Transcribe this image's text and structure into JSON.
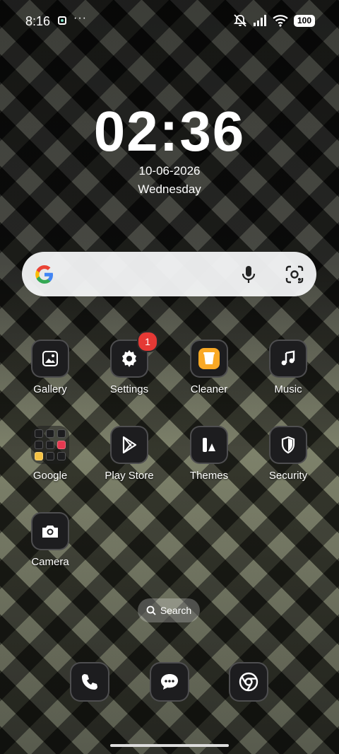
{
  "status_bar": {
    "time": "8:16",
    "more": "···",
    "battery": "100",
    "icons": [
      "notification-icon",
      "mute-icon",
      "signal-icon",
      "wifi-icon",
      "battery-icon"
    ]
  },
  "clock": {
    "time": "02:36",
    "date": "10-06-2026",
    "weekday": "Wednesday"
  },
  "google_search": {
    "icons": [
      "google-logo",
      "mic-icon",
      "lens-icon"
    ]
  },
  "apps": [
    {
      "label": "Gallery",
      "icon": "gallery-icon"
    },
    {
      "label": "Settings",
      "icon": "gear-icon",
      "badge": "1"
    },
    {
      "label": "Cleaner",
      "icon": "trash-icon"
    },
    {
      "label": "Music",
      "icon": "music-note-icon"
    },
    {
      "label": "Google",
      "icon": "folder-icon"
    },
    {
      "label": "Play Store",
      "icon": "play-store-icon"
    },
    {
      "label": "Themes",
      "icon": "themes-icon"
    },
    {
      "label": "Security",
      "icon": "shield-icon"
    },
    {
      "label": "Camera",
      "icon": "camera-icon"
    }
  ],
  "search_pill": {
    "label": "Search"
  },
  "dock": [
    {
      "icon": "phone-icon"
    },
    {
      "icon": "messages-icon"
    },
    {
      "icon": "chrome-icon"
    }
  ],
  "colors": {
    "badge": "#e53935",
    "cleaner_accent": "#f9a825",
    "tile_bg": "#1d1d1f"
  }
}
